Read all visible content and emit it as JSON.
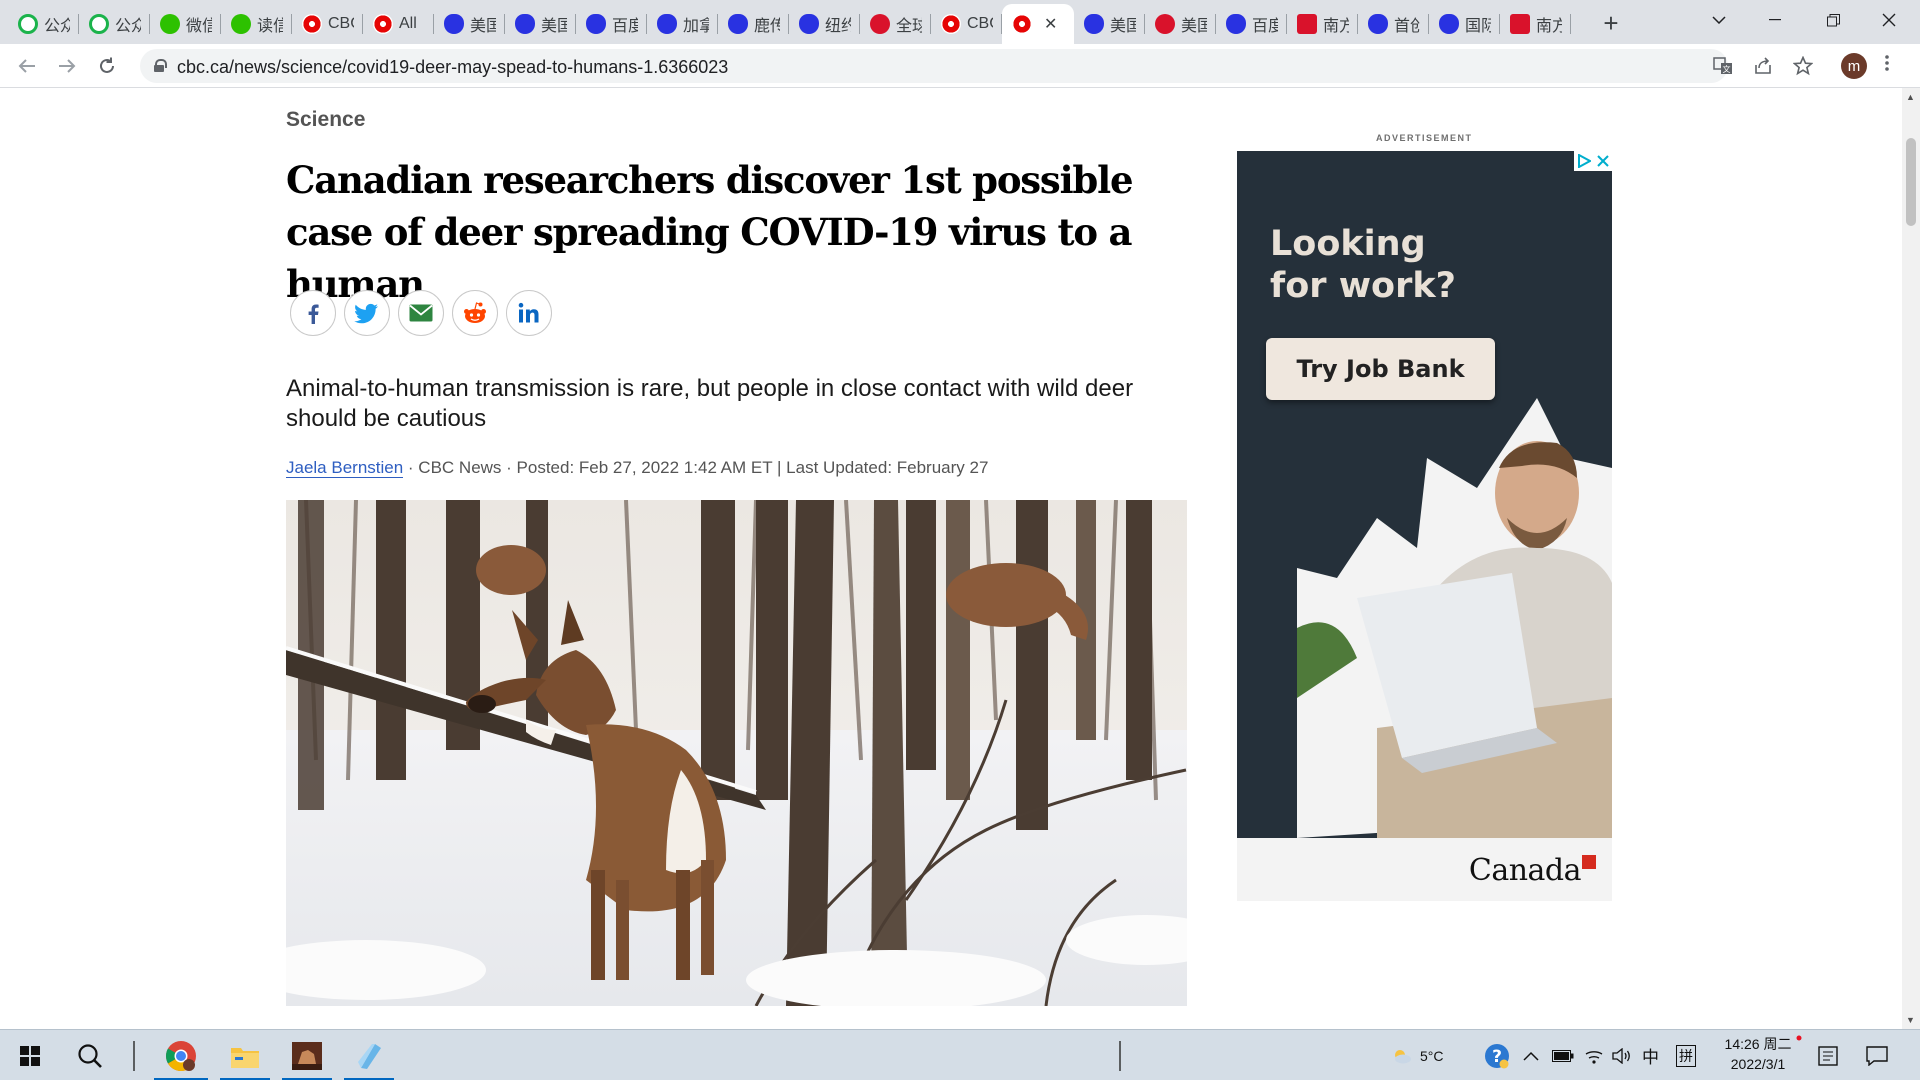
{
  "browser": {
    "tabs": [
      {
        "label": "公众",
        "favicon": "green-ring-icon"
      },
      {
        "label": "公众",
        "favicon": "green-ring-icon"
      },
      {
        "label": "微信",
        "favicon": "wechat-icon"
      },
      {
        "label": "读信",
        "favicon": "wechat-icon"
      },
      {
        "label": "CBC",
        "favicon": "cbc-gem-icon"
      },
      {
        "label": "All",
        "favicon": "cbc-gem-icon"
      },
      {
        "label": "美国",
        "favicon": "baidu-paw-icon"
      },
      {
        "label": "美国",
        "favicon": "baidu-paw-icon"
      },
      {
        "label": "百度",
        "favicon": "baidu-paw-icon"
      },
      {
        "label": "加拿",
        "favicon": "baidu-paw-icon"
      },
      {
        "label": "鹿传",
        "favicon": "baidu-paw-icon"
      },
      {
        "label": "纽约",
        "favicon": "baidu-paw-icon"
      },
      {
        "label": "全球",
        "favicon": "red-logo-icon"
      },
      {
        "label": "CBC",
        "favicon": "cbc-gem-icon"
      },
      {
        "label": "",
        "favicon": "cbc-gem-icon",
        "active": true
      },
      {
        "label": "美国",
        "favicon": "baidu-paw-icon"
      },
      {
        "label": "美国",
        "favicon": "red-round-icon"
      },
      {
        "label": "百度",
        "favicon": "baidu-paw-icon"
      },
      {
        "label": "南方",
        "favicon": "red-square-icon"
      },
      {
        "label": "首创",
        "favicon": "baidu-paw-icon"
      },
      {
        "label": "国际",
        "favicon": "baidu-paw-icon"
      },
      {
        "label": "南方",
        "favicon": "red-square-icon"
      }
    ],
    "new_tab": "+",
    "url": "cbc.ca/news/science/covid19-deer-may-spead-to-humans-1.6366023",
    "profile_initial": "m"
  },
  "article": {
    "section": "Science",
    "headline": "Canadian researchers discover 1st possible case of deer spreading COVID-19 virus to a human",
    "deck": "Animal-to-human transmission is rare, but people in close contact with wild deer should be cautious",
    "byline": {
      "author": "Jaela Bernstien",
      "rest": " · CBC News · Posted: Feb 27, 2022 1:42 AM ET | Last Updated: February 27"
    },
    "share_buttons": [
      "facebook",
      "twitter",
      "email",
      "reddit",
      "linkedin"
    ]
  },
  "ad": {
    "label": "ADVERTISEMENT",
    "headline": "Looking\nfor work?",
    "cta": "Try Job Bank",
    "brand": "Canada"
  },
  "taskbar": {
    "weather": "5°C",
    "ime_lang": "中",
    "ime_mode": "拼",
    "time": "14:26 周二",
    "date": "2022/3/1"
  },
  "colors": {
    "accent_link": "#2e5ec1",
    "tabstrip": "#dee1e6",
    "ad_bg": "#25303a",
    "taskbar": "#d4dde6"
  }
}
